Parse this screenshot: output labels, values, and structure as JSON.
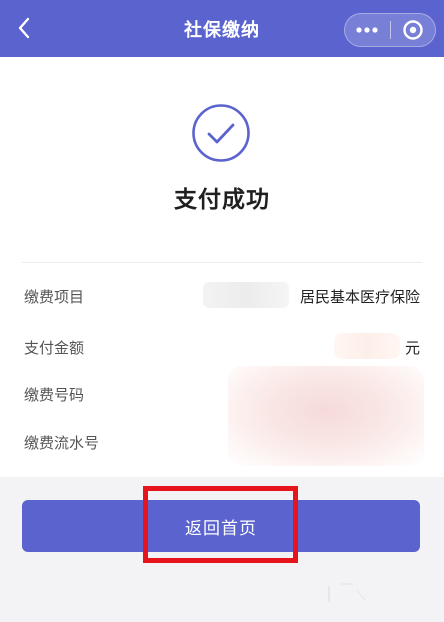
{
  "header": {
    "title": "社保缴纳",
    "bg_color": "#5b63cf"
  },
  "icons": {
    "back": "chevron-left-icon",
    "more": "more-dots-icon",
    "close": "target-circle-icon",
    "success": "check-circle-icon"
  },
  "status": {
    "text": "支付成功"
  },
  "details": [
    {
      "label": "缴费项目",
      "value": "居民基本医疗保险"
    },
    {
      "label": "支付金额",
      "value": "元"
    },
    {
      "label": "缴费号码",
      "value": ""
    },
    {
      "label": "缴费流水号",
      "value": ""
    }
  ],
  "actions": {
    "home_label": "返回首页"
  },
  "colors": {
    "accent": "#5b63cf",
    "highlight": "#e8141b",
    "footer_bg": "#f3f3f5"
  }
}
